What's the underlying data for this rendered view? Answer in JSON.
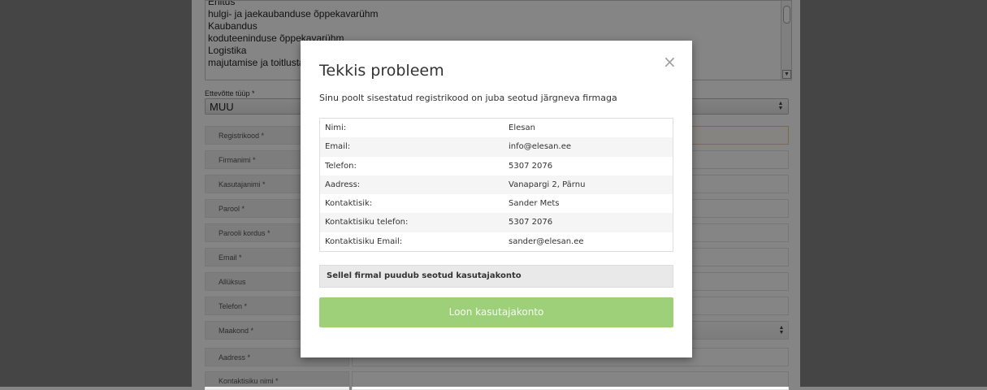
{
  "categories_list": {
    "options": [
      "Ehitus",
      "hulgi- ja jaekaubanduse õppekavarühm",
      "Kaubandus",
      "koduteeninduse õppekavarühm",
      "Logistika",
      "majutamise ja toitlustamise õppekavarühm"
    ]
  },
  "company_type": {
    "label": "Ettevõtte tüüp *",
    "value": "MUU"
  },
  "form_fields": [
    {
      "label": "Registrikood *"
    },
    {
      "label": "Firmanimi *"
    },
    {
      "label": "Kasutajanimi *"
    },
    {
      "label": "Parool *"
    },
    {
      "label": "Parooli kordus *"
    },
    {
      "label": "Email *"
    },
    {
      "label": "Allüksus"
    },
    {
      "label": "Telefon *"
    },
    {
      "label": "Maakond *"
    },
    {
      "label": "Aadress *"
    },
    {
      "label": "Kontaktisiku nimi *"
    }
  ],
  "modal": {
    "title": "Tekkis probleem",
    "close_symbol": "×",
    "intro": "Sinu poolt sisestatud registrikood on juba seotud järgneva firmaga",
    "details": [
      {
        "key": "Nimi:",
        "value": "Elesan"
      },
      {
        "key": "Email:",
        "value": "info@elesan.ee"
      },
      {
        "key": "Telefon:",
        "value": "5307 2076"
      },
      {
        "key": "Aadress:",
        "value": "Vanapargi 2, Pärnu"
      },
      {
        "key": "Kontaktisik:",
        "value": "Sander Mets"
      },
      {
        "key": "Kontaktisiku telefon:",
        "value": "5307 2076"
      },
      {
        "key": "Kontaktisiku Email:",
        "value": "sander@elesan.ee"
      }
    ],
    "notice": "Sellel firmal puudub seotud kasutajakonto",
    "button_label": "Loon kasutajakonto"
  },
  "colors": {
    "outer_background": "#858585",
    "button_green": "#9ed07a",
    "notice_gray": "#e9e9e9"
  }
}
